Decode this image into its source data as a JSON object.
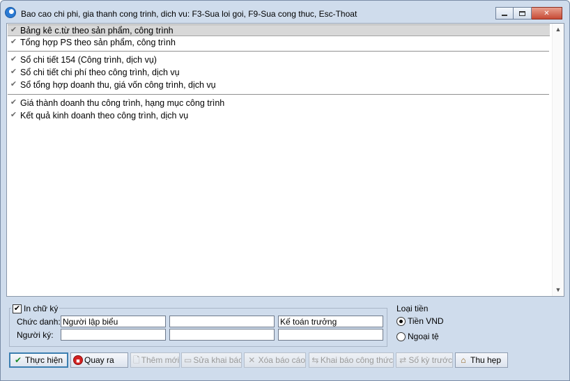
{
  "window": {
    "title": "Bao cao chi phi, gia thanh cong trinh, dich vu: F3-Sua loi goi, F9-Sua cong thuc, Esc-Thoat",
    "icon": "app-logo-icon",
    "controls": {
      "minimize": "minimize-icon",
      "maximize": "maximize-icon",
      "close": "✕"
    }
  },
  "report_list": {
    "items": [
      {
        "label": "Bảng kê c.từ theo sản phẩm, công trình",
        "checked": true,
        "selected": true
      },
      {
        "label": "Tổng hợp PS theo sản phẩm, công trình",
        "checked": true,
        "selected": false
      },
      {
        "label": "Sổ chi tiết 154 (Công trình, dịch vụ)",
        "checked": true,
        "selected": false
      },
      {
        "label": "Sổ chi tiết chi phí theo công trình, dịch vụ",
        "checked": true,
        "selected": false
      },
      {
        "label": "Sổ tổng hợp doanh thu, giá vốn công trình, dịch vụ",
        "checked": true,
        "selected": false
      },
      {
        "label": "Giá thành doanh thu công trình, hạng mục công trình",
        "checked": true,
        "selected": false
      },
      {
        "label": "Kết quả kinh doanh theo công trình, dịch vụ",
        "checked": true,
        "selected": false
      }
    ],
    "check_glyph": "✔"
  },
  "signature": {
    "print_label": "In chữ ký",
    "print_checked": true,
    "title_label": "Chức danh:",
    "signer_label": "Người ký:",
    "titles": [
      "Người lập biểu",
      "",
      "Kế toán trưởng"
    ],
    "signers": [
      "",
      "",
      ""
    ]
  },
  "currency": {
    "label": "Loại tiền",
    "options": [
      {
        "label": "Tiền VND",
        "selected": true
      },
      {
        "label": "Ngoại tệ",
        "selected": false
      }
    ]
  },
  "buttons": {
    "execute": "Thực hiện",
    "back": "Quay ra",
    "add": "Thêm mới",
    "edit": "Sửa khai báo",
    "delete": "Xóa báo cáo",
    "formula": "Khai báo công thức",
    "previous": "Số kỳ trước",
    "narrow": "Thu hẹp"
  },
  "glyphs": {
    "check": "✔",
    "stop": "■",
    "add": "🗋",
    "edit": "▭",
    "delete": "✕",
    "formula": "⇆",
    "previous": "⇄",
    "narrow": "⌂"
  }
}
